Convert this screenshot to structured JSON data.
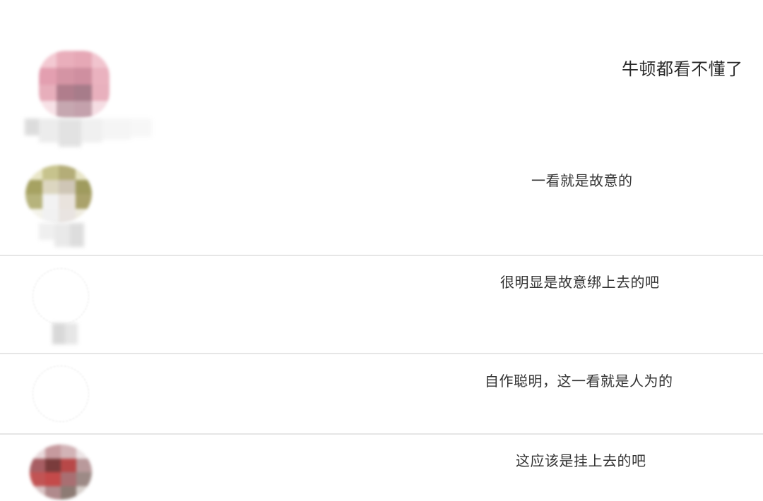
{
  "comments": [
    {
      "text": "牛顿都看不懂了"
    },
    {
      "text": "一看就是故意的"
    },
    {
      "text": "很明显是故意绑上去的吧"
    },
    {
      "text": "自作聪明，这一看就是人为的"
    },
    {
      "text": "这应该是挂上去的吧"
    }
  ],
  "avatar_colors": {
    "pink": "#e7a8b5",
    "pink_dark": "#a77c8a",
    "olive": "#a6a262",
    "olive_light": "#d6d2a8",
    "red": "#b84848",
    "red_dark": "#7a3c3c",
    "grey": "#d9d9d9"
  }
}
